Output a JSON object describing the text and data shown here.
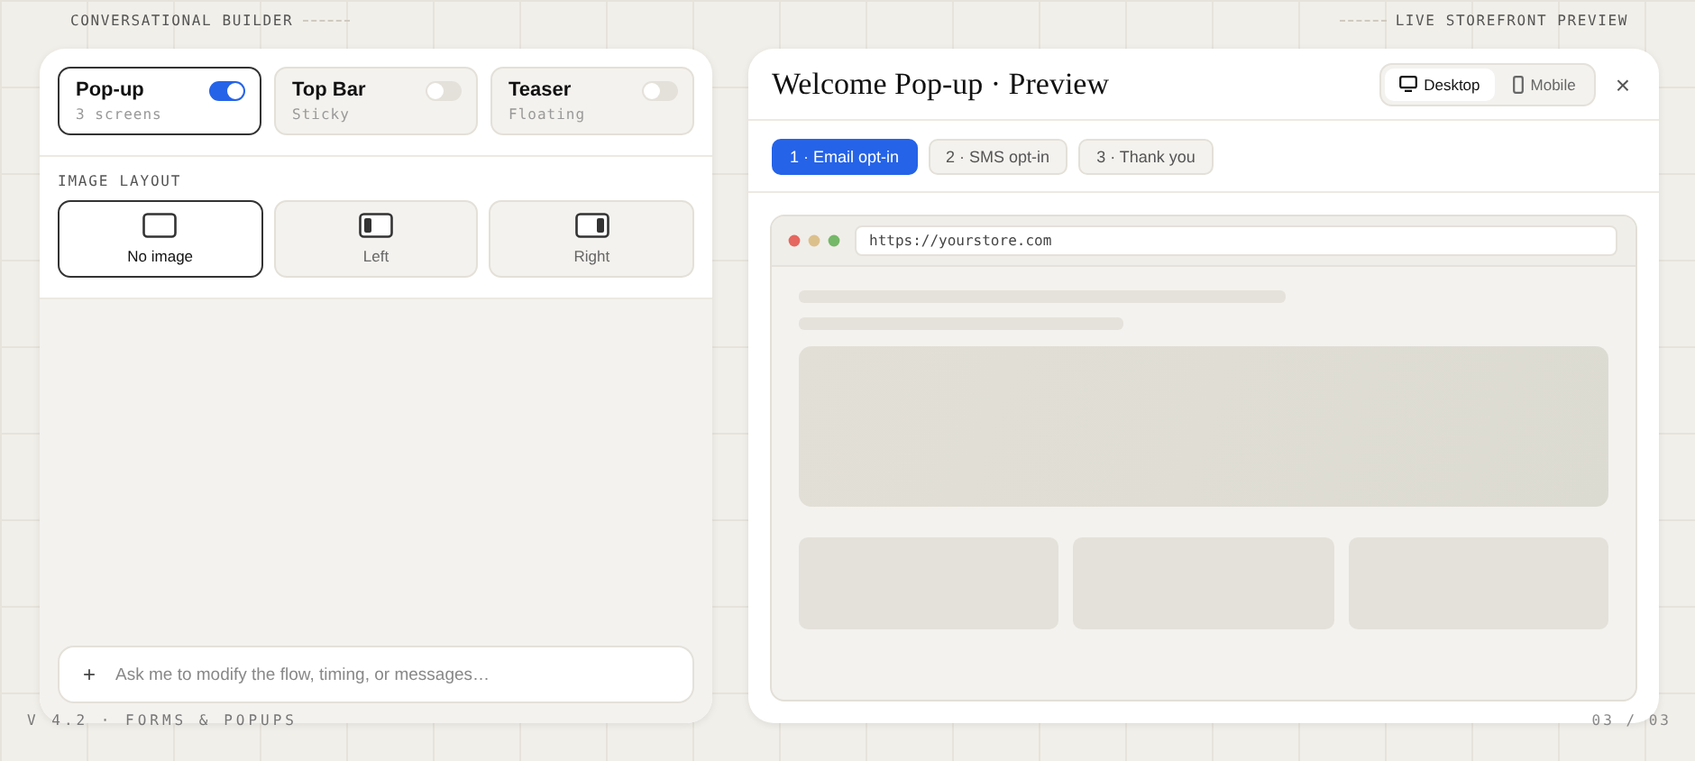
{
  "builder": {
    "label": "CONVERSATIONAL BUILDER",
    "formats": [
      {
        "name": "Pop-up",
        "subtitle": "3 screens",
        "on": true,
        "selected": true
      },
      {
        "name": "Top Bar",
        "subtitle": "Sticky",
        "on": false,
        "selected": false
      },
      {
        "name": "Teaser",
        "subtitle": "Floating",
        "on": false,
        "selected": false
      }
    ],
    "image_layout": {
      "title": "IMAGE LAYOUT",
      "options": [
        {
          "kind": "none",
          "label": "No image",
          "selected": true
        },
        {
          "kind": "left",
          "label": "Left",
          "selected": false
        },
        {
          "kind": "right",
          "label": "Right",
          "selected": false
        }
      ]
    },
    "chat": {
      "button": "+",
      "placeholder": "Ask me to modify the flow, timing, or messages…"
    }
  },
  "preview": {
    "label": "LIVE STOREFRONT PREVIEW",
    "title": "Welcome Pop-up · Preview",
    "devices": [
      {
        "kind": "desktop",
        "label": "Desktop",
        "selected": true
      },
      {
        "kind": "mobile",
        "label": "Mobile",
        "selected": false
      }
    ],
    "close": "×",
    "steps": [
      {
        "label": "1 · Email opt-in",
        "selected": true
      },
      {
        "label": "2 · SMS opt-in",
        "selected": false
      },
      {
        "label": "3 · Thank you",
        "selected": false
      }
    ],
    "browser": {
      "url": "https://yourstore.com"
    }
  },
  "footer": {
    "version": "V 4.2 · FORMS & POPUPS",
    "page": "03 / 03"
  }
}
